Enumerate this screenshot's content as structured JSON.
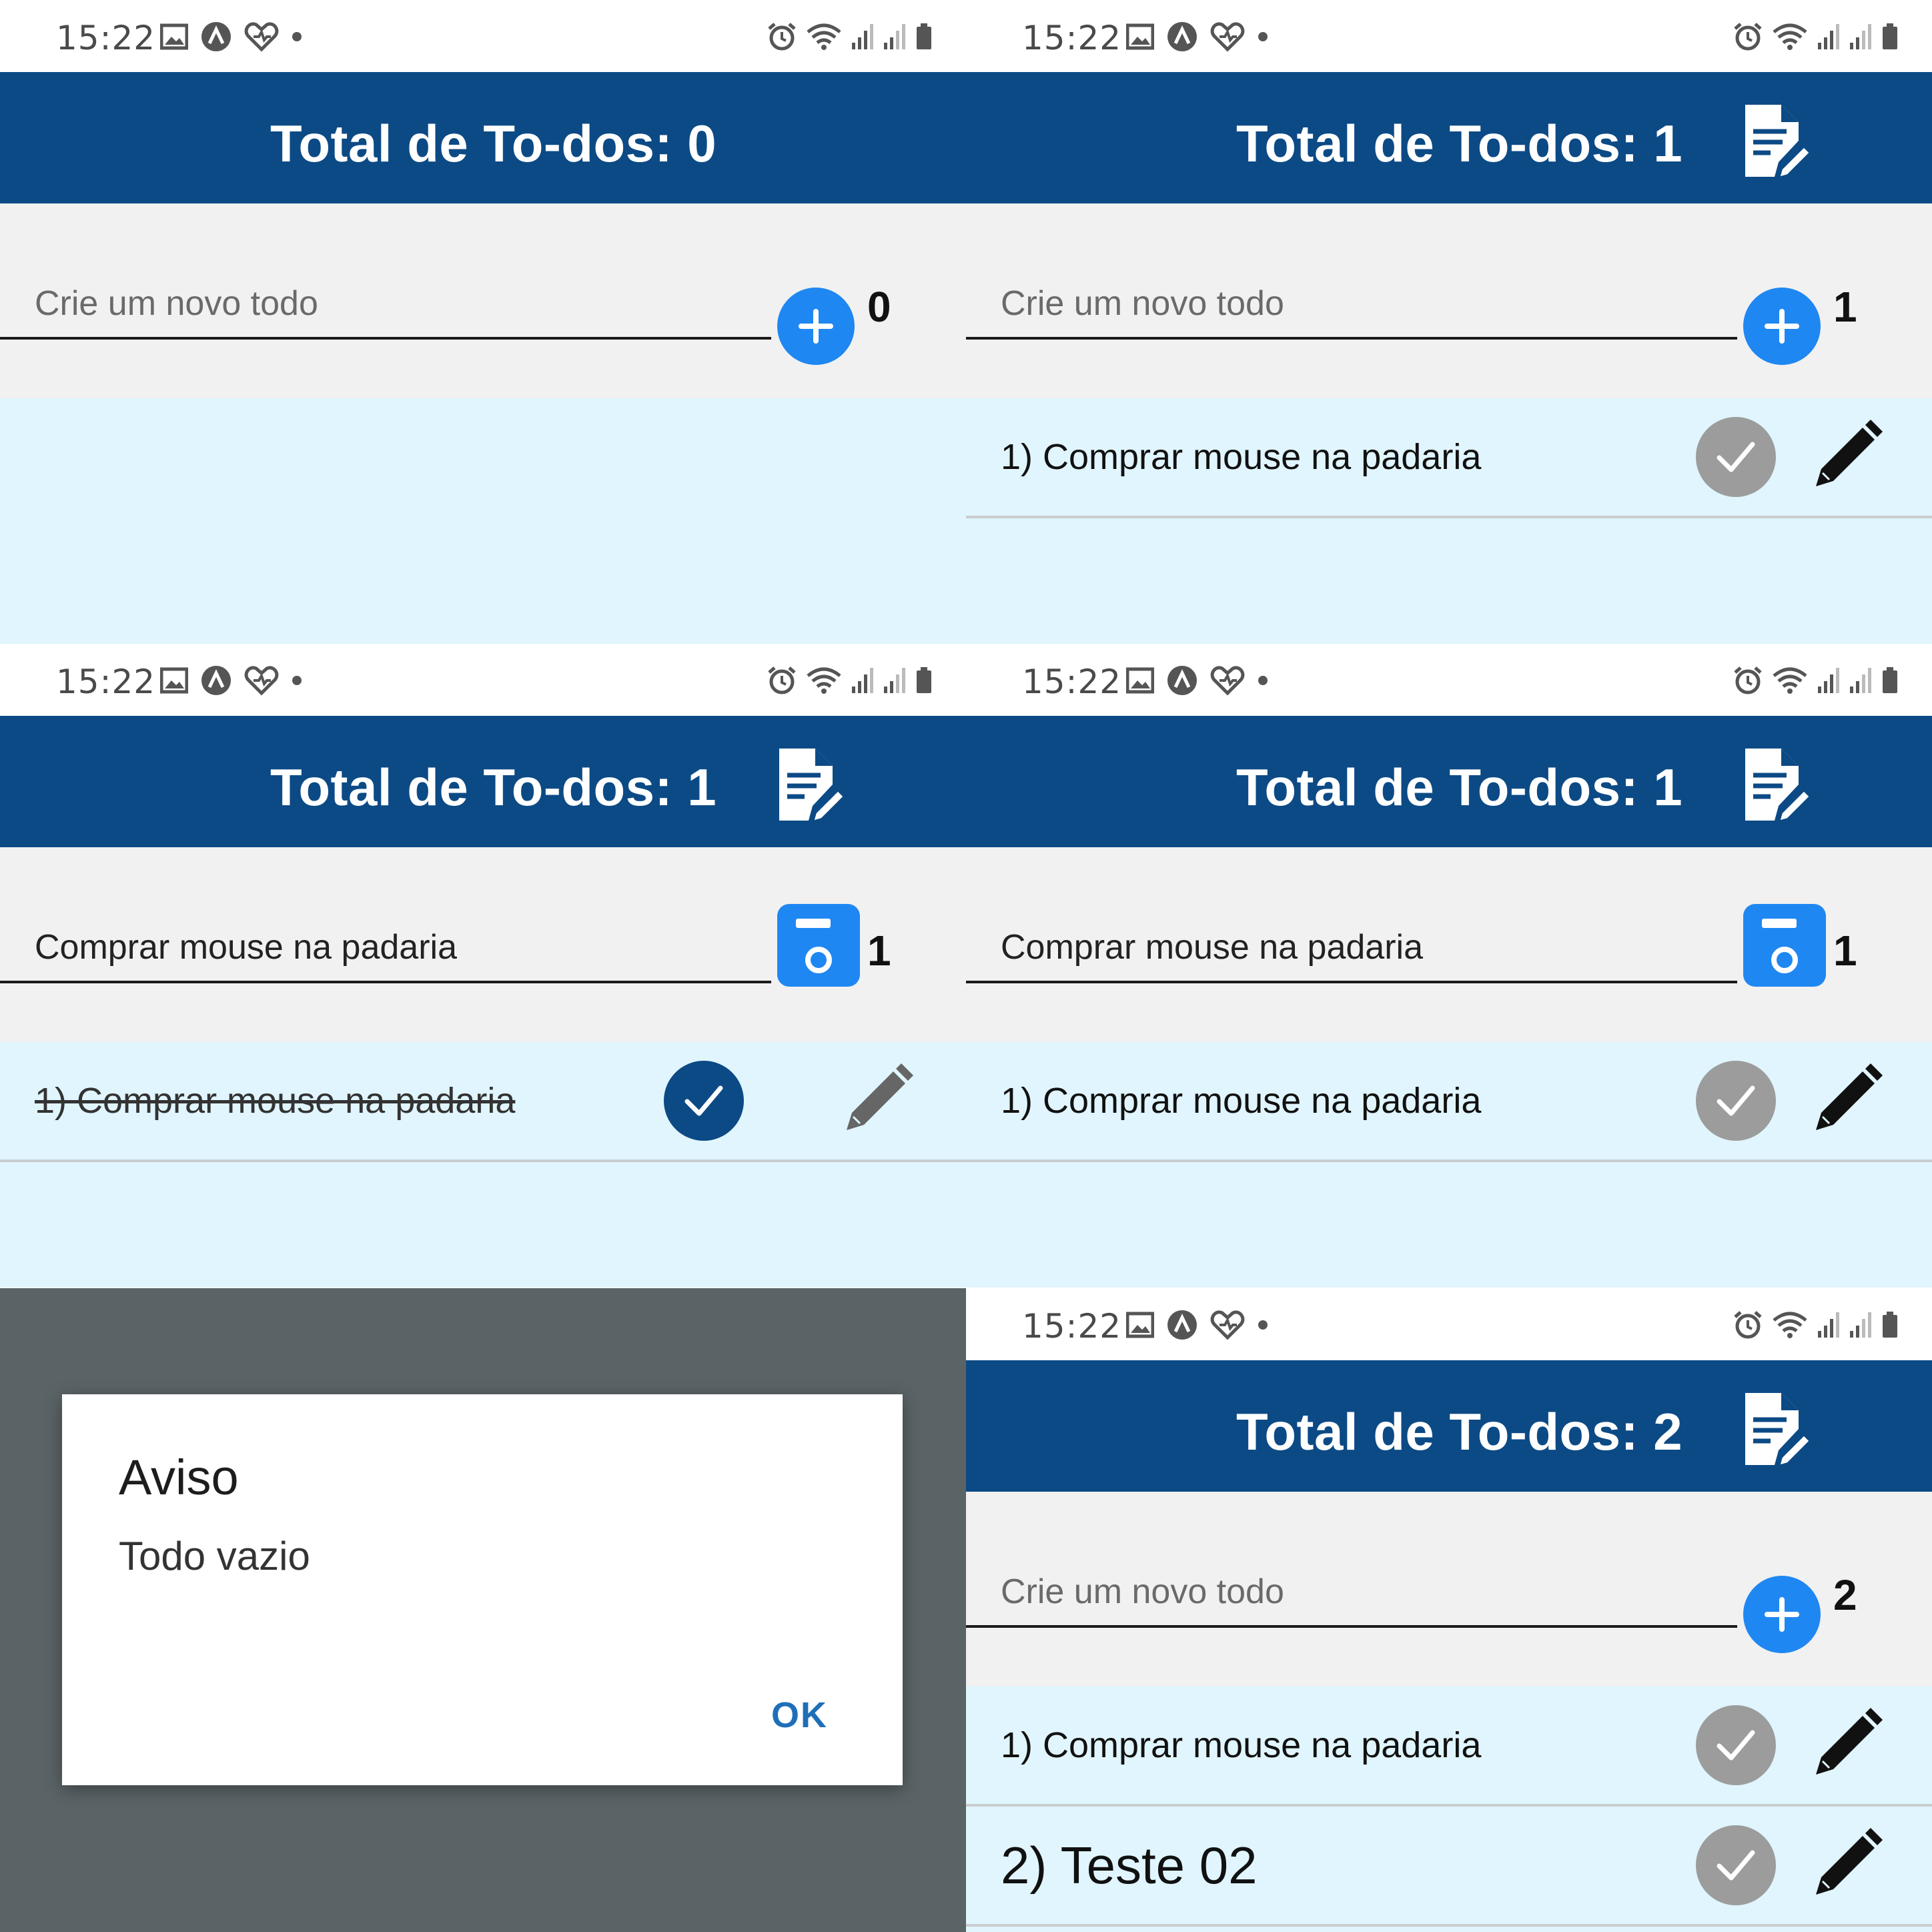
{
  "status_bar": {
    "time": "15:22"
  },
  "input": {
    "placeholder": "Crie um novo todo",
    "edit_value": "Comprar mouse na padaria"
  },
  "screens": [
    {
      "title": "Total de To-dos: 0",
      "counter": "0"
    },
    {
      "title": "Total de To-dos: 1",
      "counter": "1",
      "items": [
        "1) Comprar mouse na padaria"
      ]
    },
    {
      "title": "Total de To-dos: 1",
      "counter": "1",
      "items": [
        "1) Comprar mouse na padaria"
      ]
    },
    {
      "title": "Total de To-dos: 1",
      "counter": "1",
      "items": [
        "1) Comprar mouse na padaria"
      ]
    },
    {
      "title": "Total de To-dos: 2",
      "counter": "2",
      "items": [
        "1) Comprar mouse na padaria",
        "2) Teste 02"
      ]
    }
  ],
  "dialog": {
    "title": "Aviso",
    "message": "Todo vazio",
    "ok_label": "OK"
  },
  "colors": {
    "appbar": "#0c4a85",
    "accent": "#1f87f2",
    "list_bg": "#e0f5fd",
    "input_area_bg": "#f1f1f1",
    "check_off": "#9c9c9c",
    "check_on": "#0c4a85",
    "dialog_ok": "#1e6fb8"
  },
  "icons": {
    "appbar_action": "edit-document-icon",
    "add": "plus-icon",
    "save": "floppy-disk-icon",
    "complete": "check-icon",
    "edit": "pencil-icon"
  }
}
